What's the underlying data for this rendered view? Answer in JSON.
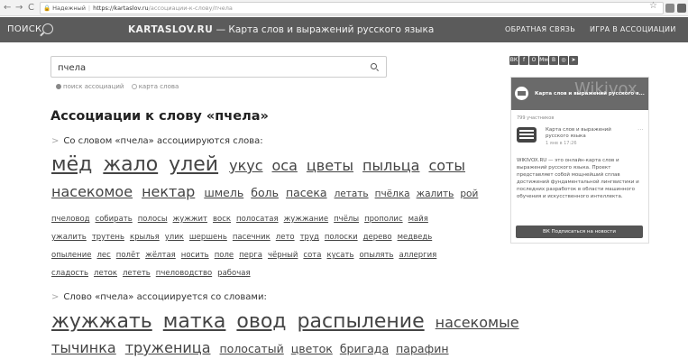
{
  "browser": {
    "back": "←",
    "forward": "→",
    "reload": "C",
    "lock": "🔒",
    "secure_label": "Надежный",
    "url_host": "https://kartaslov.ru",
    "url_path": "/ассоциации-к-слову/пчела",
    "star": "☆"
  },
  "header": {
    "search_label": "ПОИСК",
    "brand_name": "KARTASLOV.RU",
    "brand_tagline": "— Карта слов и выражений русского языка",
    "feedback": "ОБРАТНАЯ СВЯЗЬ",
    "game": "ИГРА В АССОЦИАЦИИ"
  },
  "search": {
    "value": "пчела",
    "option_associations": "поиск ассоциаций",
    "option_map": "карта слова"
  },
  "page": {
    "title": "Ассоциации к слову «пчела»",
    "section1_heading": "Со словом «пчела» ассоциируются слова:",
    "section2_heading": "Слово «пчела» ассоциируется со словами:"
  },
  "section1_lines": [
    [
      [
        "мёд",
        "s1"
      ],
      [
        "жало",
        "s1"
      ],
      [
        "улей",
        "s1"
      ],
      [
        "укус",
        "s2"
      ],
      [
        "оса",
        "s2"
      ],
      [
        "цветы",
        "s2"
      ],
      [
        "пыльца",
        "s2"
      ],
      [
        "соты",
        "s2"
      ]
    ],
    [
      [
        "насекомое",
        "s2"
      ],
      [
        "нектар",
        "s2"
      ],
      [
        "шмель",
        "s3"
      ],
      [
        "боль",
        "s3"
      ],
      [
        "пасека",
        "s3"
      ],
      [
        "летать",
        "s4"
      ],
      [
        "пчёлка",
        "s4"
      ],
      [
        "жалить",
        "s4"
      ],
      [
        "рой",
        "s4"
      ]
    ],
    [
      [
        "пчеловод",
        "s5"
      ],
      [
        "собирать",
        "s5"
      ],
      [
        "полосы",
        "s5"
      ],
      [
        "жужжит",
        "s5"
      ],
      [
        "воск",
        "s5"
      ],
      [
        "полосатая",
        "s5"
      ],
      [
        "жужжание",
        "s5"
      ],
      [
        "пчёлы",
        "s5"
      ],
      [
        "прополис",
        "s5"
      ],
      [
        "майя",
        "s5"
      ]
    ],
    [
      [
        "ужалить",
        "s5"
      ],
      [
        "трутень",
        "s5"
      ],
      [
        "крылья",
        "s5"
      ],
      [
        "улик",
        "s5"
      ],
      [
        "шершень",
        "s5"
      ],
      [
        "пасечник",
        "s5"
      ],
      [
        "лето",
        "s5"
      ],
      [
        "труд",
        "s5"
      ],
      [
        "полоски",
        "s5"
      ],
      [
        "дерево",
        "s5"
      ],
      [
        "медведь",
        "s5"
      ]
    ],
    [
      [
        "опыление",
        "s5"
      ],
      [
        "лес",
        "s5"
      ],
      [
        "полёт",
        "s5"
      ],
      [
        "жёлтая",
        "s5"
      ],
      [
        "носить",
        "s5"
      ],
      [
        "поле",
        "s5"
      ],
      [
        "перга",
        "s5"
      ],
      [
        "чёрный",
        "s5"
      ],
      [
        "сота",
        "s5"
      ],
      [
        "кусать",
        "s5"
      ],
      [
        "опылять",
        "s5"
      ],
      [
        "аллергия",
        "s5"
      ]
    ],
    [
      [
        "сладость",
        "s5"
      ],
      [
        "леток",
        "s5"
      ],
      [
        "лететь",
        "s5"
      ],
      [
        "пчеловодство",
        "s5"
      ],
      [
        "рабочая",
        "s5"
      ]
    ]
  ],
  "section2_lines": [
    [
      [
        "жужжать",
        "s1"
      ],
      [
        "матка",
        "s1"
      ],
      [
        "овод",
        "s1"
      ],
      [
        "распыление",
        "s1"
      ],
      [
        "насекомые",
        "s2"
      ]
    ],
    [
      [
        "тычинка",
        "s2"
      ],
      [
        "труженица",
        "s2"
      ],
      [
        "полосатый",
        "s3"
      ],
      [
        "цветок",
        "s3"
      ],
      [
        "бригада",
        "s3"
      ],
      [
        "парафин",
        "s3"
      ]
    ]
  ],
  "social_icons": [
    "ВК",
    "f",
    "О",
    "Мм",
    "В",
    "◎",
    "➤"
  ],
  "widget": {
    "watermark": "Wikivox",
    "title": "Карта слов и выражений русского я...",
    "members": "799 участников",
    "post_name": "Карта слов и выражений русского языка",
    "post_date": "1 янв в 17:26",
    "dots": "···",
    "description": "WIKIVOX.RU — это онлайн-карта слов и выражений русского языка. Проект представляет собой мощнейший сплав достижений фундаментальной лингвистики и последних разработок в области машинного обучения и искусственного интеллекта.",
    "subscribe": "ВК  Подписаться на новости"
  },
  "colors": {
    "header_bg": "#5b5b5b",
    "link": "#444444"
  }
}
